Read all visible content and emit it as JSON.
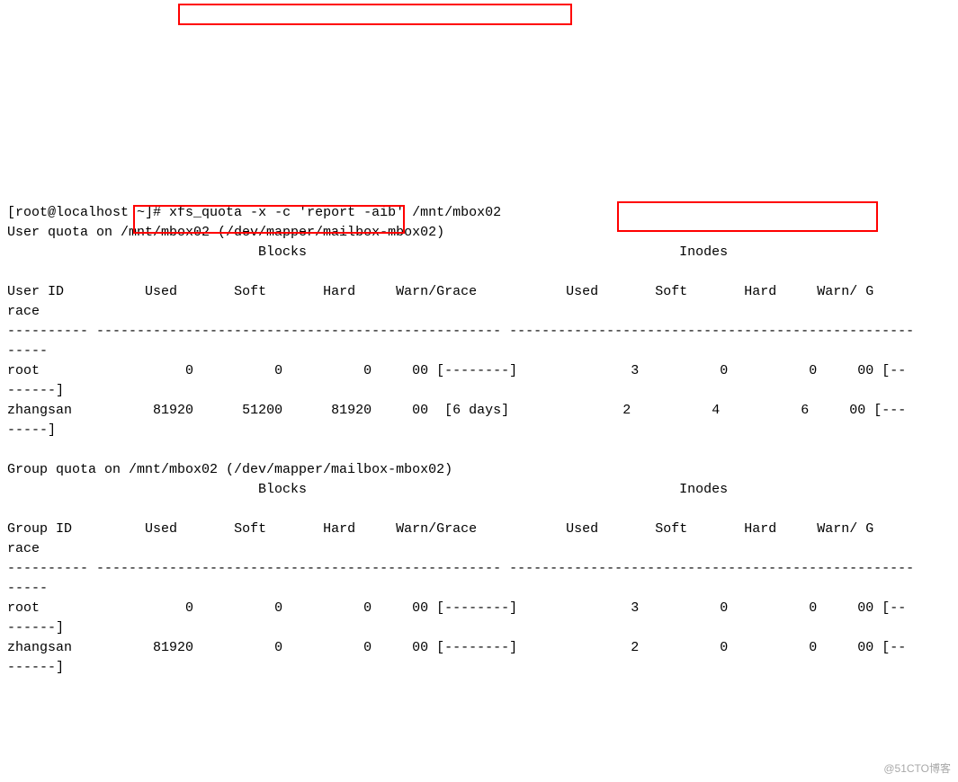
{
  "prompt": {
    "user": "root",
    "host": "localhost",
    "dir": "~",
    "symbol": "#",
    "full": "[root@localhost ~]#"
  },
  "command": "xfs_quota -x -c 'report -aib' /mnt/mbox02",
  "user_quota_header": "User quota on /mnt/mbox02 (/dev/mapper/mailbox-mbox02)",
  "group_quota_header": "Group quota on /mnt/mbox02 (/dev/mapper/mailbox-mbox02)",
  "col_section_blocks": "Blocks",
  "col_section_inodes": "Inodes",
  "cols": {
    "user_id": "User ID",
    "group_id": "Group ID",
    "used": "Used",
    "soft": "Soft",
    "hard": "Hard",
    "warn_grace": "Warn/Grace",
    "warn_g": "Warn/ G",
    "race_wrap": "race"
  },
  "divider_line": "---------- -------------------------------------------------- --------------------------------------------------",
  "divider_tail": "-----",
  "user_rows": [
    {
      "id": "root",
      "blocks": {
        "used": "0",
        "soft": "0",
        "hard": "0",
        "warn": "00 [--------]"
      },
      "inodes": {
        "used": "3",
        "soft": "0",
        "hard": "0",
        "warn": "00 [--"
      },
      "tail": "------]"
    },
    {
      "id": "zhangsan",
      "blocks": {
        "used": "81920",
        "soft": "51200",
        "hard": "81920",
        "warn": "00  [6 days]"
      },
      "inodes": {
        "used": "2",
        "soft": "4",
        "hard": "6",
        "warn": "00 [---"
      },
      "tail": "-----]"
    }
  ],
  "group_rows": [
    {
      "id": "root",
      "blocks": {
        "used": "0",
        "soft": "0",
        "hard": "0",
        "warn": "00 [--------]"
      },
      "inodes": {
        "used": "3",
        "soft": "0",
        "hard": "0",
        "warn": "00 [--"
      },
      "tail": "------]"
    },
    {
      "id": "zhangsan",
      "blocks": {
        "used": "81920",
        "soft": "0",
        "hard": "0",
        "warn": "00 [--------]"
      },
      "inodes": {
        "used": "2",
        "soft": "0",
        "hard": "0",
        "warn": "00 [--"
      },
      "tail": "------]"
    }
  ],
  "watermark": "@51CTO博客"
}
